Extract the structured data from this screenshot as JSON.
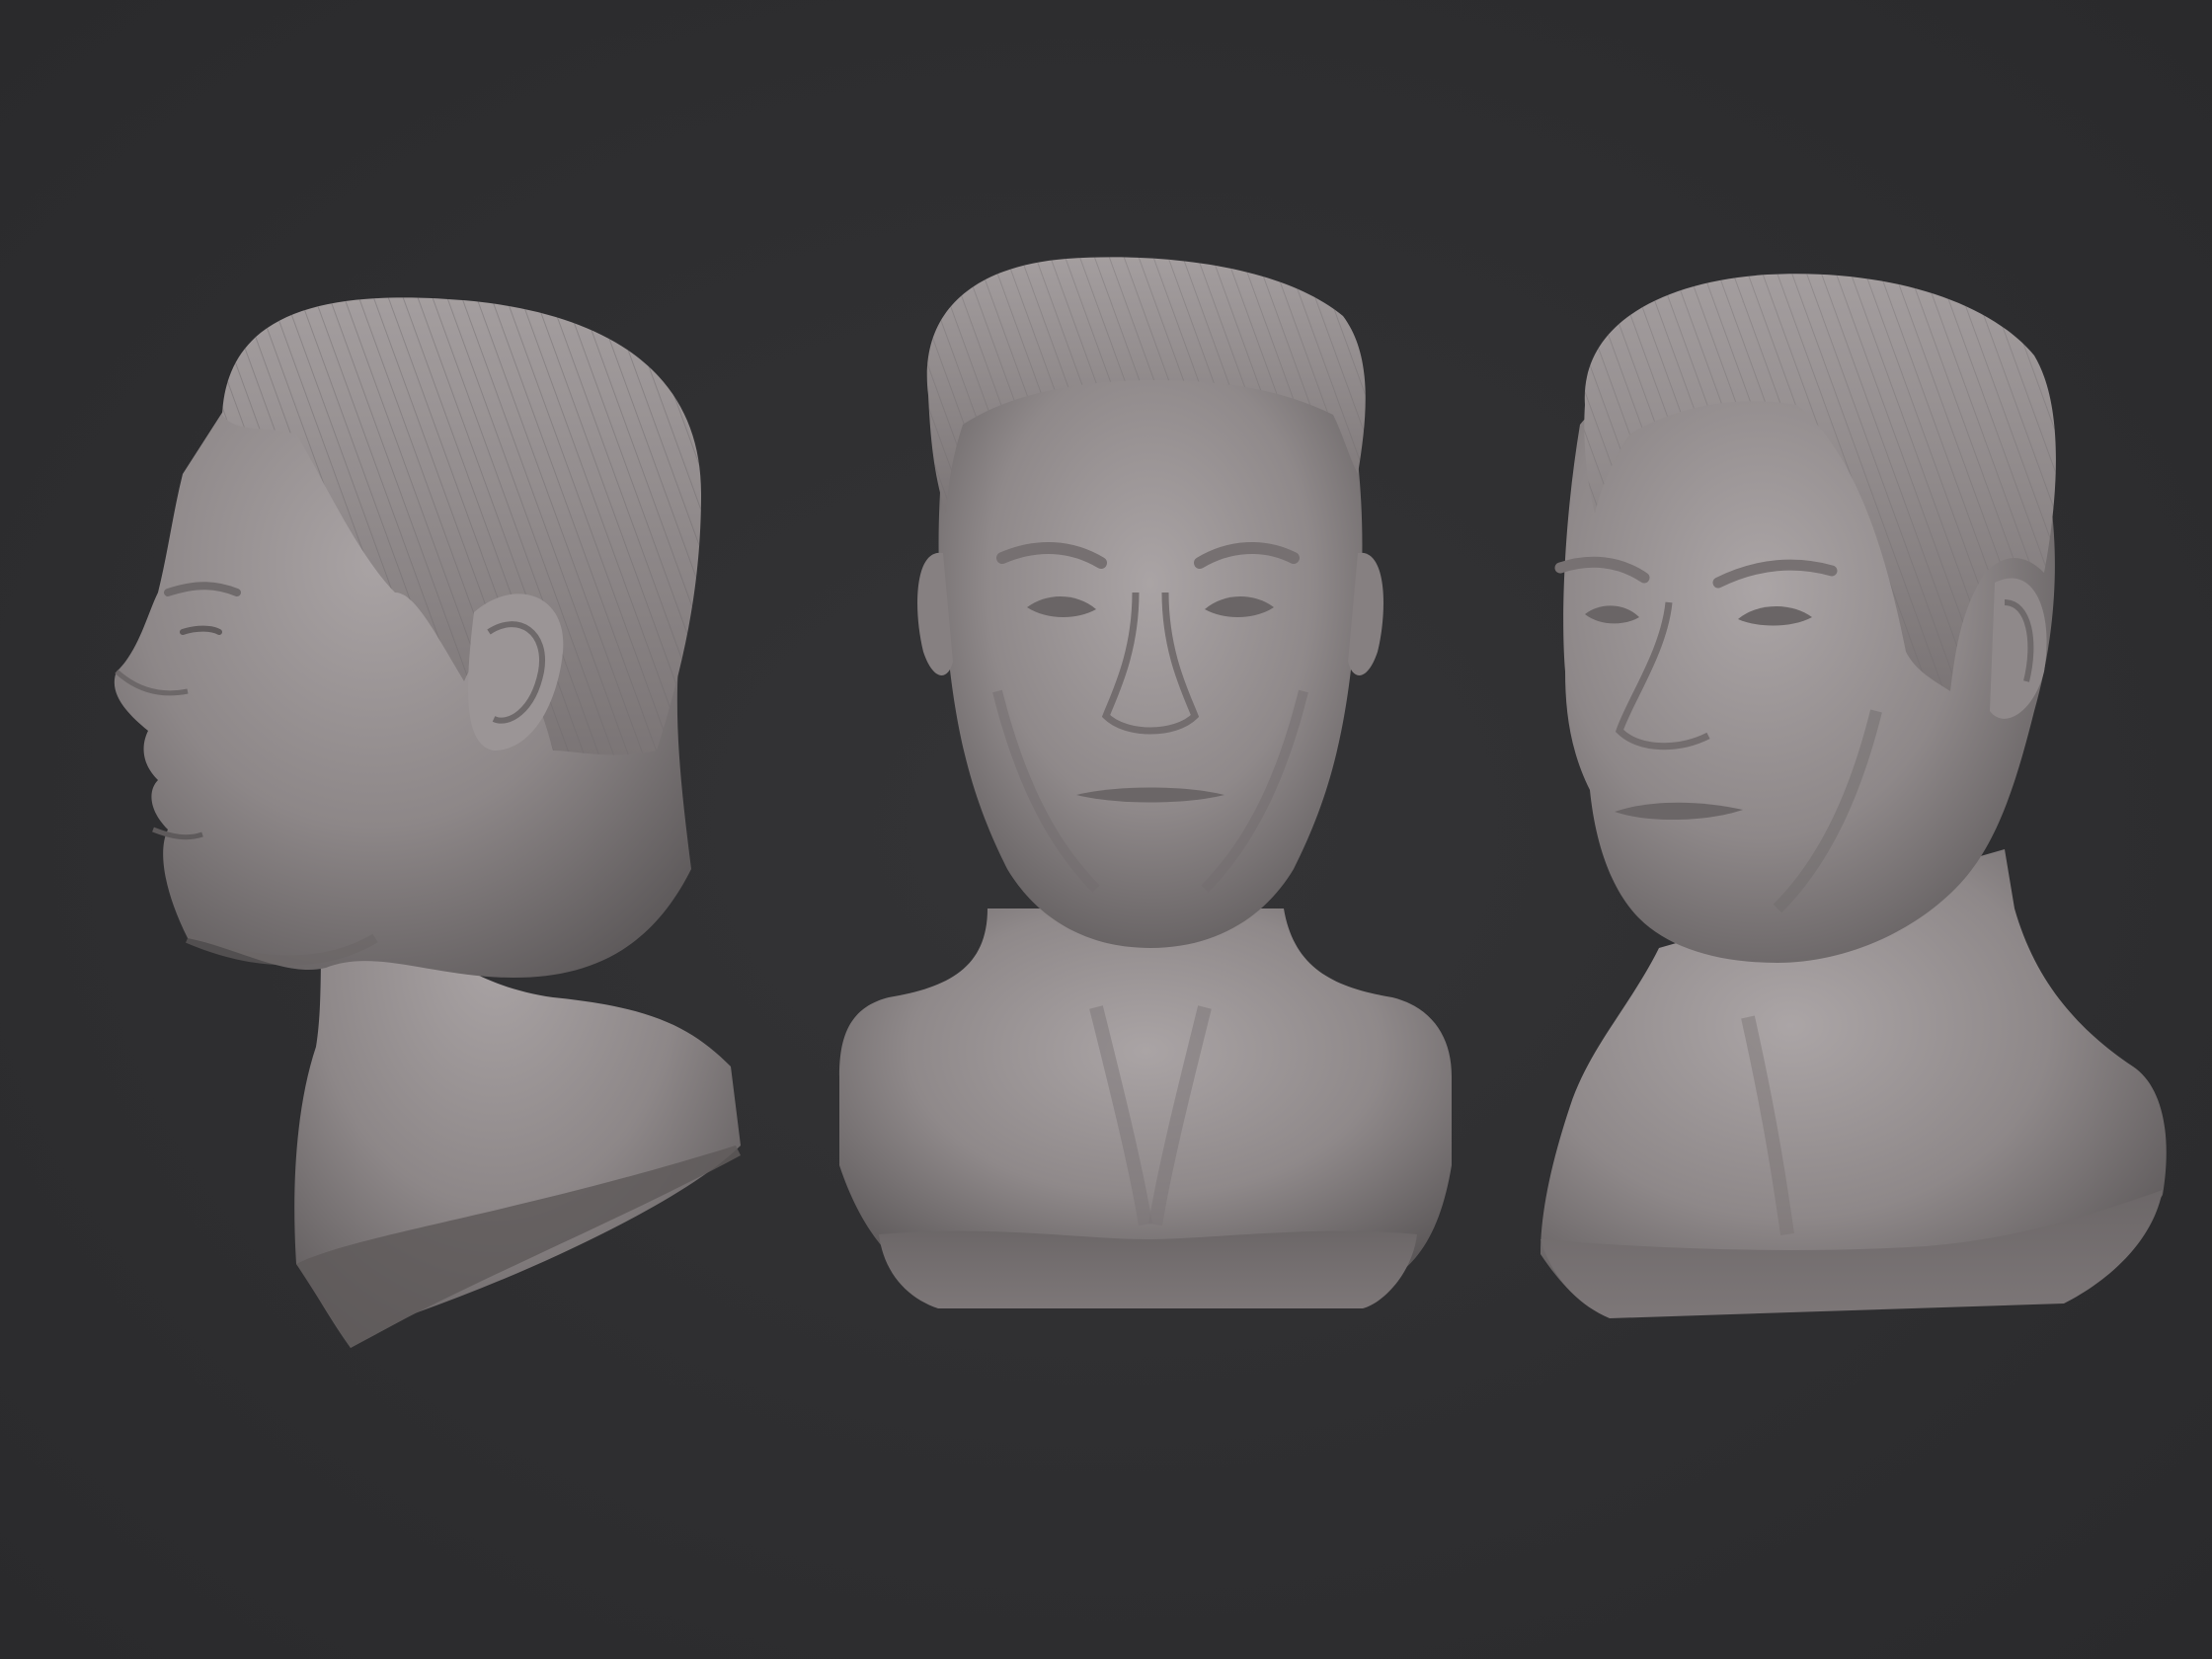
{
  "scene": {
    "background_color": "#2f2f31",
    "clay_color": "#8c8687",
    "views": [
      {
        "name": "side-profile-view"
      },
      {
        "name": "front-view"
      },
      {
        "name": "three-quarter-view"
      }
    ]
  }
}
